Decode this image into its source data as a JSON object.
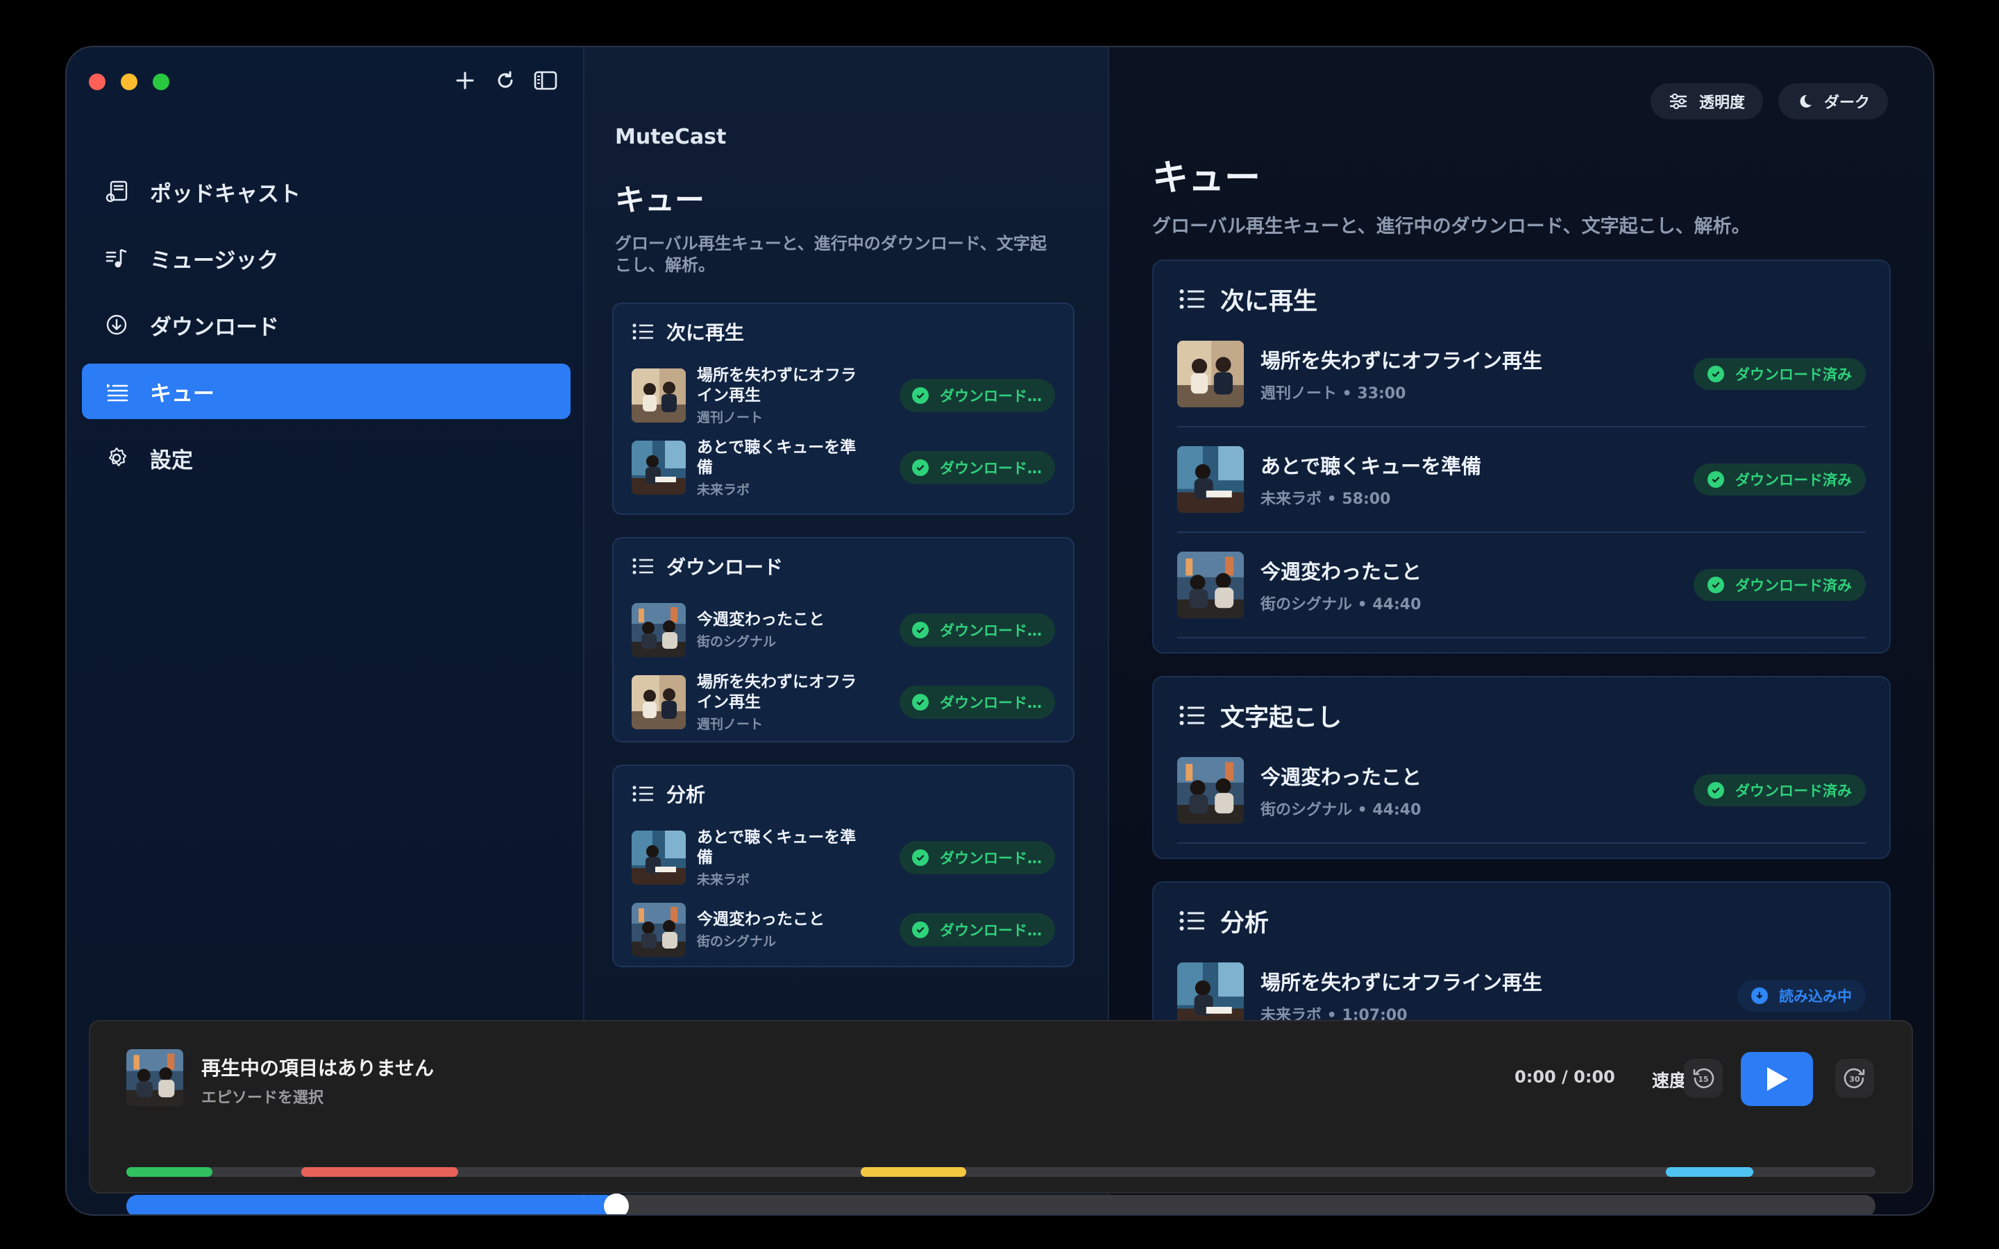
{
  "app_name": "MuteCast",
  "sidebar": {
    "items": [
      {
        "label": "ポッドキャスト",
        "icon": "podcast-icon"
      },
      {
        "label": "ミュージック",
        "icon": "music-icon"
      },
      {
        "label": "ダウンロード",
        "icon": "download-icon"
      },
      {
        "label": "キュー",
        "icon": "queue-icon",
        "active": true
      },
      {
        "label": "設定",
        "icon": "gear-icon"
      }
    ]
  },
  "page": {
    "title": "キュー",
    "subtitle": "グローバル再生キューと、進行中のダウンロード、文字起こし、解析。"
  },
  "middle": {
    "sections": [
      {
        "title": "次に再生",
        "rows": [
          {
            "title": "場所を失わずにオフライン再生",
            "source": "週刊ノート",
            "status": "ダウンロード…"
          },
          {
            "title": "あとで聴くキューを準備",
            "source": "未来ラボ",
            "status": "ダウンロード…"
          }
        ]
      },
      {
        "title": "ダウンロード",
        "rows": [
          {
            "title": "今週変わったこと",
            "source": "街のシグナル",
            "status": "ダウンロード…"
          },
          {
            "title": "場所を失わずにオフライン再生",
            "source": "週刊ノート",
            "status": "ダウンロード…"
          }
        ]
      },
      {
        "title": "分析",
        "rows": [
          {
            "title": "あとで聴くキューを準備",
            "source": "未来ラボ",
            "status": "ダウンロード…"
          },
          {
            "title": "今週変わったこと",
            "source": "街のシグナル",
            "status": "ダウンロード…"
          }
        ]
      }
    ]
  },
  "toolbar": {
    "transparency_label": "透明度",
    "dark_label": "ダーク"
  },
  "right": {
    "sections": [
      {
        "title": "次に再生",
        "rows": [
          {
            "title": "場所を失わずにオフライン再生",
            "meta": "週刊ノート • 33:00",
            "status": "ダウンロード済み"
          },
          {
            "title": "あとで聴くキューを準備",
            "meta": "未来ラボ • 58:00",
            "status": "ダウンロード済み"
          },
          {
            "title": "今週変わったこと",
            "meta": "街のシグナル • 44:40",
            "status": "ダウンロード済み"
          }
        ]
      },
      {
        "title": "文字起こし",
        "rows": [
          {
            "title": "今週変わったこと",
            "meta": "街のシグナル • 44:40",
            "status": "ダウンロード済み"
          }
        ]
      },
      {
        "title": "分析",
        "rows": [
          {
            "title": "場所を失わずにオフライン再生",
            "meta": "未来ラボ • 1:07:00",
            "status": "読み込み中"
          }
        ]
      }
    ]
  },
  "player": {
    "title": "再生中の項目はありません",
    "subtitle": "エピソードを選択",
    "time": "0:00 / 0:00",
    "speed_label": "速度",
    "skip_back_label": "15",
    "skip_forward_label": "30",
    "progress": 0.28,
    "segment_colors": [
      "#30c060",
      "#e8625a",
      "#f5c842",
      "#4fc3f0"
    ]
  },
  "colors": {
    "accent": "#2b7cf5",
    "success": "#2ed27a"
  }
}
